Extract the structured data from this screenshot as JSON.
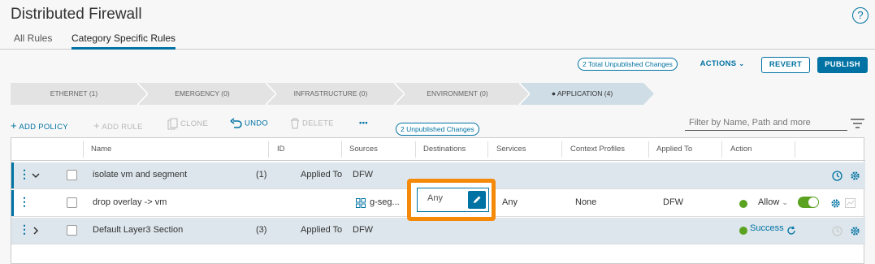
{
  "page": {
    "title": "Distributed Firewall",
    "help": "?"
  },
  "tabs": [
    {
      "label": "All Rules"
    },
    {
      "label": "Category Specific Rules"
    }
  ],
  "header_actions": {
    "unpublished_badge": "2 Total Unpublished Changes",
    "actions_label": "ACTIONS",
    "revert_label": "REVERT",
    "publish_label": "PUBLISH"
  },
  "categories": [
    {
      "label": "ETHERNET (1)"
    },
    {
      "label": "EMERGENCY (0)"
    },
    {
      "label": "INFRASTRUCTURE (0)"
    },
    {
      "label": "ENVIRONMENT (0)"
    },
    {
      "label": "APPLICATION (4)",
      "active": true
    }
  ],
  "toolbar": {
    "add_policy": "ADD POLICY",
    "add_rule": "ADD RULE",
    "clone": "CLONE",
    "undo": "UNDO",
    "delete": "DELETE",
    "more": "•••",
    "unpublished_badge": "2 Unpublished Changes",
    "filter_placeholder": "Filter by Name, Path and more"
  },
  "columns": [
    "Name",
    "ID",
    "Sources",
    "Destinations",
    "Services",
    "Context Profiles",
    "Applied To",
    "Action"
  ],
  "rows": [
    {
      "name": "isolate vm and segment",
      "count": "(1)",
      "applied_label": "Applied To",
      "applied_value": "DFW"
    },
    {
      "name": "drop overlay -> vm",
      "sources": "g-seg...",
      "destinations": "Any",
      "services": "Any",
      "context_profiles": "None",
      "applied_to": "DFW",
      "action": "Allow"
    },
    {
      "name": "Default Layer3 Section",
      "count": "(3)",
      "applied_label": "Applied To",
      "applied_value": "DFW",
      "status": "Success"
    }
  ],
  "colors": {
    "accent": "#0072a3",
    "highlight": "#f58a0a",
    "success": "#5aa220"
  }
}
